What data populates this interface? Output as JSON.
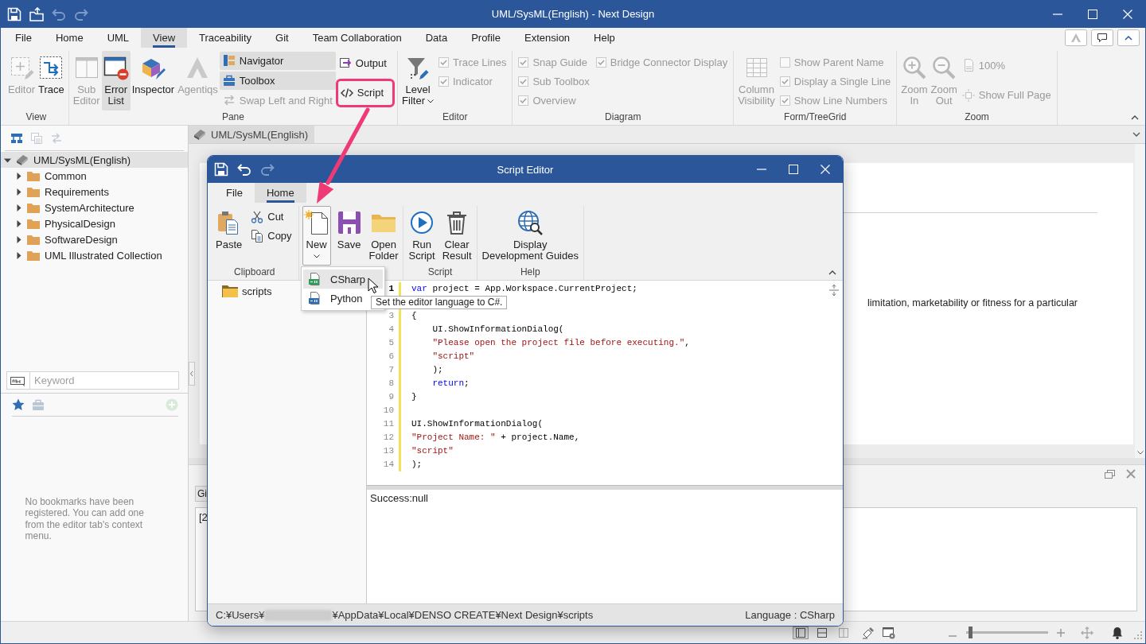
{
  "window": {
    "title": "UML/SysML(English) - Next Design",
    "quick_access": [
      {
        "disabled": false
      },
      {
        "disabled": false
      },
      {
        "disabled": true
      },
      {
        "disabled": true
      }
    ]
  },
  "menu_tabs": [
    {
      "label": "File",
      "selected": false
    },
    {
      "label": "Home",
      "selected": false
    },
    {
      "label": "UML",
      "selected": false
    },
    {
      "label": "View",
      "selected": true
    },
    {
      "label": "Traceability",
      "selected": false
    },
    {
      "label": "Git",
      "selected": false
    },
    {
      "label": "Team Collaboration",
      "selected": false
    },
    {
      "label": "Data",
      "selected": false
    },
    {
      "label": "Profile",
      "selected": false
    },
    {
      "label": "Extension",
      "selected": false
    },
    {
      "label": "Help",
      "selected": false
    }
  ],
  "ribbon": {
    "groups": [
      {
        "label": "View",
        "columns": [
          {
            "kind": "large",
            "label": "Editor",
            "disabled": true,
            "on": false
          },
          {
            "kind": "large",
            "label": "Trace",
            "disabled": false,
            "on": false
          }
        ]
      },
      {
        "label": "Pane",
        "columns": [
          {
            "kind": "large",
            "label": "Sub\nEditor",
            "disabled": true,
            "on": false
          },
          {
            "kind": "large",
            "label": "Error\nList",
            "disabled": false,
            "on": true
          },
          {
            "kind": "large",
            "label": "Inspector",
            "disabled": false,
            "on": false
          },
          {
            "kind": "large",
            "label": "Agentiqs",
            "disabled": true,
            "on": false
          },
          {
            "kind": "stack",
            "items": [
              {
                "kind": "button",
                "label": "Navigator",
                "disabled": false,
                "on": true
              },
              {
                "kind": "button",
                "label": "Toolbox",
                "disabled": false,
                "on": true
              },
              {
                "kind": "button",
                "label": "Swap Left and Right",
                "disabled": true,
                "on": false
              }
            ]
          },
          {
            "kind": "stack",
            "items": [
              {
                "kind": "button",
                "label": "Output",
                "disabled": false,
                "on": false,
                "highlighted": false
              },
              {
                "kind": "button",
                "label": "Script",
                "disabled": false,
                "on": false,
                "highlighted": true
              }
            ]
          }
        ]
      },
      {
        "label": "Editor",
        "columns": [
          {
            "kind": "large",
            "label": "Level\nFilter",
            "dropdown": true,
            "disabled": false,
            "on": false
          },
          {
            "kind": "stack",
            "items": [
              {
                "kind": "check",
                "label": "Trace Lines",
                "checked": true,
                "disabled": true
              },
              {
                "kind": "check",
                "label": "Indicator",
                "checked": true,
                "disabled": true
              }
            ]
          }
        ]
      },
      {
        "label": "Diagram",
        "columns": [
          {
            "kind": "stack",
            "items": [
              {
                "kind": "check",
                "label": "Snap Guide",
                "checked": true,
                "disabled": true
              },
              {
                "kind": "check",
                "label": "Sub Toolbox",
                "checked": true,
                "disabled": true
              },
              {
                "kind": "check",
                "label": "Overview",
                "checked": true,
                "disabled": true
              }
            ]
          },
          {
            "kind": "stack",
            "items": [
              {
                "kind": "check",
                "label": "Bridge Connector Display",
                "checked": true,
                "disabled": true
              }
            ]
          }
        ]
      },
      {
        "label": "Form/TreeGrid",
        "columns": [
          {
            "kind": "large",
            "label": "Column\nVisibility",
            "disabled": true,
            "on": false
          },
          {
            "kind": "stack",
            "items": [
              {
                "kind": "check",
                "label": "Show Parent Name",
                "checked": false,
                "disabled": true
              },
              {
                "kind": "check",
                "label": "Display a Single Line",
                "checked": true,
                "disabled": true
              },
              {
                "kind": "check",
                "label": "Show Line Numbers",
                "checked": true,
                "disabled": true
              }
            ]
          }
        ]
      },
      {
        "label": "Zoom",
        "columns": [
          {
            "kind": "large",
            "label": "Zoom\nIn",
            "disabled": true,
            "on": false
          },
          {
            "kind": "large",
            "label": "Zoom\nOut",
            "disabled": true,
            "on": false
          },
          {
            "kind": "stack",
            "items": [
              {
                "kind": "button",
                "label": "100%",
                "disabled": true,
                "on": false
              },
              {
                "kind": "button",
                "label": "Show Full Page",
                "disabled": true,
                "on": false
              }
            ]
          }
        ]
      }
    ]
  },
  "project_tree": {
    "toolbar": [
      {
        "disabled": false
      },
      {
        "disabled": true
      },
      {
        "disabled": true
      }
    ],
    "items": [
      {
        "kind": "project",
        "label": "UML/SysML(English)",
        "expanded": true,
        "selected": true,
        "children": [
          {
            "kind": "folder",
            "label": "Common",
            "expanded": false,
            "selected": false
          },
          {
            "kind": "folder",
            "label": "Requirements",
            "expanded": false,
            "selected": false
          },
          {
            "kind": "folder",
            "label": "SystemArchitecture",
            "expanded": false,
            "selected": false
          },
          {
            "kind": "folder",
            "label": "PhysicalDesign",
            "expanded": false,
            "selected": false
          },
          {
            "kind": "folder",
            "label": "SoftwareDesign",
            "expanded": false,
            "selected": false
          },
          {
            "kind": "folder",
            "label": "UML Illustrated Collection",
            "expanded": false,
            "selected": false
          }
        ]
      }
    ],
    "search": {
      "placeholder": "Keyword"
    }
  },
  "bookmarks": {
    "tabs": [
      {
        "selected": true
      },
      {
        "selected": false
      }
    ],
    "add_button": {
      "disabled": true
    },
    "message": "No bookmarks have been registered. You can add one from the editor tab's context menu."
  },
  "document_tabs": [
    {
      "label": "UML/SysML(English)",
      "selected": true
    }
  ],
  "document": {
    "text": "limitation, marketability or fitness for a particular"
  },
  "output_panel": {
    "tab": "Gi",
    "text": "[2"
  },
  "status_bar": {
    "layout_buttons": [
      {
        "selected": true
      },
      {
        "selected": false
      },
      {
        "selected": false
      }
    ],
    "zoom_slider": {
      "level": 0.05
    }
  },
  "script_editor": {
    "title": "Script Editor",
    "quick_access": [
      {
        "disabled": false
      },
      {
        "disabled": false
      },
      {
        "disabled": true
      }
    ],
    "tabs": [
      {
        "label": "File",
        "selected": false
      },
      {
        "label": "Home",
        "selected": true
      }
    ],
    "ribbon": {
      "groups": [
        {
          "label": "Clipboard",
          "columns": [
            {
              "kind": "large",
              "label": "Paste"
            },
            {
              "kind": "stack",
              "items": [
                {
                  "kind": "button",
                  "label": "Cut"
                },
                {
                  "kind": "button",
                  "label": "Copy"
                }
              ]
            }
          ]
        },
        {
          "columns": [
            {
              "kind": "large",
              "label": "New",
              "dropdown": true,
              "open": true
            },
            {
              "kind": "large",
              "label": "Save",
              "open": false
            },
            {
              "kind": "large",
              "label": "Open\nFolder",
              "open": false
            }
          ]
        },
        {
          "label": "Script",
          "columns": [
            {
              "kind": "large",
              "label": "Run\nScript"
            },
            {
              "kind": "large",
              "label": "Clear\nResult"
            }
          ]
        },
        {
          "label": "Help",
          "columns": [
            {
              "kind": "large",
              "label": "Display\nDevelopment Guides"
            }
          ]
        }
      ]
    },
    "new_menu": [
      {
        "label": "CSharp",
        "selected": true
      },
      {
        "label": "Python",
        "selected": false
      }
    ],
    "tooltip": "Set the editor language to C#.",
    "folders": [
      {
        "label": "scripts"
      }
    ],
    "code_lines": [
      {
        "number": "1",
        "current": true,
        "tokens": [
          {
            "kind": "keyword",
            "text": "var"
          },
          {
            "kind": "plain",
            "text": " project = App.Workspace.CurrentProject;"
          }
        ]
      },
      {
        "number": "3",
        "current": false,
        "tokens": [
          {
            "kind": "plain",
            "text": "{"
          }
        ]
      },
      {
        "number": "4",
        "current": false,
        "tokens": [
          {
            "kind": "plain",
            "text": "    UI.ShowInformationDialog("
          }
        ]
      },
      {
        "number": "5",
        "current": false,
        "tokens": [
          {
            "kind": "string",
            "text": "    \"Please open the project file before executing.\""
          },
          {
            "kind": "plain",
            "text": ","
          }
        ]
      },
      {
        "number": "6",
        "current": false,
        "tokens": [
          {
            "kind": "string",
            "text": "    \"script\""
          }
        ]
      },
      {
        "number": "7",
        "current": false,
        "tokens": [
          {
            "kind": "plain",
            "text": "    );"
          }
        ]
      },
      {
        "number": "8",
        "current": false,
        "tokens": [
          {
            "kind": "keyword",
            "text": "    return"
          },
          {
            "kind": "plain",
            "text": ";"
          }
        ]
      },
      {
        "number": "9",
        "current": false,
        "tokens": [
          {
            "kind": "plain",
            "text": "}"
          }
        ]
      },
      {
        "number": "10",
        "current": false
      },
      {
        "number": "11",
        "current": false,
        "tokens": [
          {
            "kind": "plain",
            "text": "UI.ShowInformationDialog("
          }
        ]
      },
      {
        "number": "12",
        "current": false,
        "tokens": [
          {
            "kind": "string",
            "text": "\"Project Name: \""
          },
          {
            "kind": "plain",
            "text": " + project.Name,"
          }
        ]
      },
      {
        "number": "13",
        "current": false,
        "tokens": [
          {
            "kind": "string",
            "text": "\"script\""
          }
        ]
      },
      {
        "number": "14",
        "current": false,
        "tokens": [
          {
            "kind": "plain",
            "text": ");"
          }
        ]
      }
    ],
    "result": "Success:null",
    "status": {
      "path_start": "C:¥Users¥",
      "path_end": "¥AppData¥Local¥DENSO CREATE¥Next Design¥scripts",
      "language": "Language : CSharp"
    }
  }
}
